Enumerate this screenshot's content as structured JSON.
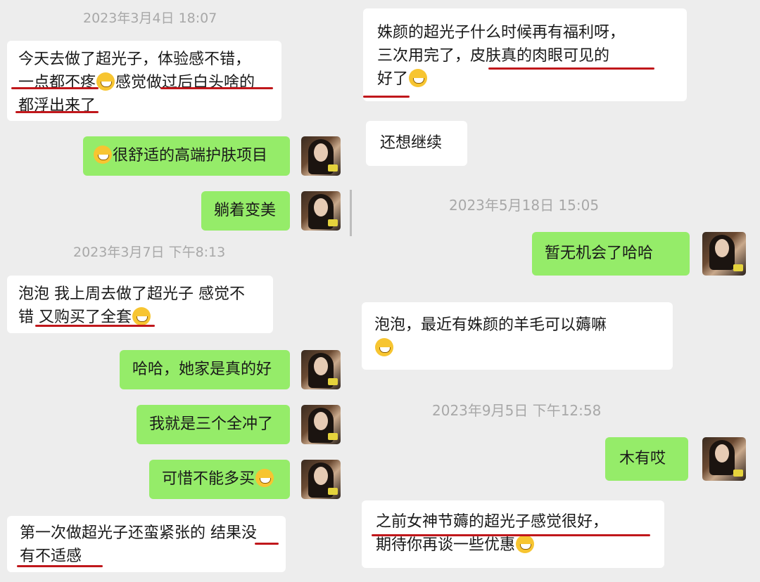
{
  "left": {
    "timestamps": [
      "2023年3月4日 18:07",
      "2023年3月7日 下午8:13"
    ],
    "messages": [
      {
        "line1": "今天去做了超光子，体验感不错，",
        "line2a": "一点都不疼",
        "line2b": "感觉做过后白头啥的",
        "line3": "都浮出来了"
      },
      {
        "text": "很舒适的高端护肤项目"
      },
      {
        "text": "躺着变美"
      },
      {
        "line1": "泡泡  我上周去做了超光子 感觉不",
        "line2a": "错 又购买了全套"
      },
      {
        "text": "哈哈，她家是真的好"
      },
      {
        "text": "我就是三个全冲了"
      },
      {
        "text": "可惜不能多买"
      },
      {
        "line1": "第一次做超光子还蛮紧张的  结果没",
        "line2": "有不适感"
      }
    ]
  },
  "right": {
    "timestamps": [
      "2023年5月18日 15:05",
      "2023年9月5日 下午12:58"
    ],
    "messages": [
      {
        "line1": "姝颜的超光子什么时候再有福利呀，",
        "line2": "三次用完了，皮肤真的肉眼可见的",
        "line3a": "好了"
      },
      {
        "text": "还想继续"
      },
      {
        "text": "暂无机会了哈哈"
      },
      {
        "line1": "泡泡，最近有姝颜的羊毛可以薅嘛"
      },
      {
        "text": "木有哎"
      },
      {
        "line1": "之前女神节薅的超光子感觉很好，",
        "line2": "期待你再谈一些优惠"
      }
    ]
  },
  "colors": {
    "bg": "#ededed",
    "incoming": "#ffffff",
    "outgoing": "#95ec69",
    "underline": "#c0171b"
  }
}
